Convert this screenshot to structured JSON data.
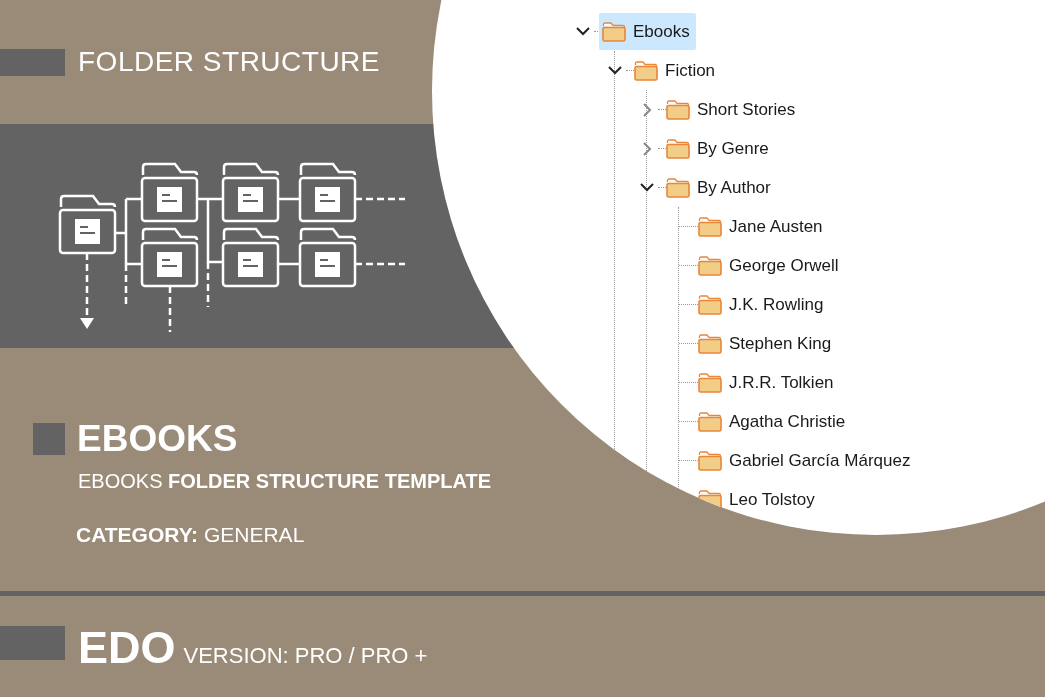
{
  "header": {
    "title": "FOLDER STRUCTURE"
  },
  "template": {
    "name": "EBOOKS",
    "subtitle": "EBOOKS **FOLDER STRUCTURE TEMPLATE**",
    "category": "**CATEGORY:** GENERAL"
  },
  "footer": {
    "product": "EDO",
    "version": "VERSION: PRO / PRO +"
  },
  "tree": [
    {
      "label": "Ebooks",
      "expanded": true,
      "selected": true,
      "children": [
        {
          "label": "Fiction",
          "expanded": true,
          "selected": false,
          "children": [
            {
              "label": "Short Stories",
              "expanded": false,
              "selected": false
            },
            {
              "label": "By Genre",
              "expanded": false,
              "selected": false
            },
            {
              "label": "By Author",
              "expanded": true,
              "selected": false,
              "children": [
                {
                  "label": "Jane Austen",
                  "selected": false
                },
                {
                  "label": "George Orwell",
                  "selected": false
                },
                {
                  "label": "J.K. Rowling",
                  "selected": false
                },
                {
                  "label": "Stephen King",
                  "selected": false
                },
                {
                  "label": "J.R.R. Tolkien",
                  "selected": false
                },
                {
                  "label": "Agatha Christie",
                  "selected": false
                },
                {
                  "label": "Gabriel García Márquez",
                  "selected": false
                },
                {
                  "label": "Leo Tolstoy",
                  "selected": false
                }
              ]
            }
          ]
        }
      ]
    }
  ]
}
